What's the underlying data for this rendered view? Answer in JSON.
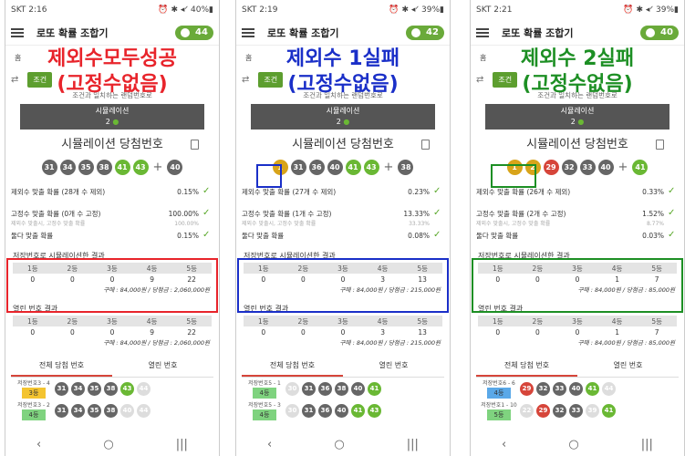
{
  "colors": {
    "red": "#e8242b",
    "blue": "#1a2fc8",
    "green": "#1d8f24",
    "badge_green": "#6aaa3a"
  },
  "phones": [
    {
      "status_time": "SKT 2:16",
      "status_right": "⏰ ✱ ◂ᐟ 40%▮",
      "app_title": "로또 확률 조합기",
      "count": "44",
      "nav_home": "홈",
      "filter_chip": "조건",
      "subtitle": "조건과 일치하는 랜덤번호로",
      "sim_label": "시뮬레이션",
      "sim_count": "2",
      "result_title": "시뮬레이션 당첨번호",
      "balls": [
        {
          "n": "31",
          "c": "gray"
        },
        {
          "n": "34",
          "c": "gray"
        },
        {
          "n": "35",
          "c": "gray"
        },
        {
          "n": "38",
          "c": "gray"
        },
        {
          "n": "41",
          "c": "green"
        },
        {
          "n": "43",
          "c": "green"
        }
      ],
      "bonus": {
        "n": "40",
        "c": "gray"
      },
      "prob1_label": "제외수 맞출 확률 (28개 수 제외)",
      "prob1_val": "0.15%",
      "prob2_label": "고정수 맞출 확률 (0개 수 고정)",
      "prob2_val": "100.00%",
      "note_label": "제외수 맞출시, 고정수 맞출 확률",
      "note_val": "100.00%",
      "prob3_label": "둘다 맞출 확률",
      "prob3_val": "0.15%",
      "saved_title": "저장번호로 시뮬레이션한 결과",
      "saved_vals": [
        "0",
        "0",
        "0",
        "9",
        "22"
      ],
      "saved_summary": "구매 : 84,000원 / 당첨금 : 2,060,000원",
      "open_title": "열린 번호 결과",
      "open_vals": [
        "0",
        "0",
        "0",
        "9",
        "22"
      ],
      "open_summary": "구매 : 84,000원 / 당첨금 : 2,060,000원",
      "tab1": "전체 당첨 번호",
      "tab2": "열린 번호",
      "hist": [
        {
          "label": "저장번호3 - 4",
          "rank": "3등",
          "rank_color": "#f4c430",
          "balls": [
            {
              "n": "31",
              "c": "gray"
            },
            {
              "n": "34",
              "c": "gray"
            },
            {
              "n": "35",
              "c": "gray"
            },
            {
              "n": "38",
              "c": "gray"
            },
            {
              "n": "43",
              "c": "green"
            },
            {
              "n": "44",
              "c": "light"
            }
          ]
        },
        {
          "label": "저장번호3 - 2",
          "rank": "4등",
          "rank_color": "#7fd37f",
          "balls": [
            {
              "n": "31",
              "c": "gray"
            },
            {
              "n": "34",
              "c": "gray"
            },
            {
              "n": "35",
              "c": "gray"
            },
            {
              "n": "38",
              "c": "gray"
            },
            {
              "n": "40",
              "c": "light"
            },
            {
              "n": "44",
              "c": "light"
            }
          ]
        }
      ],
      "overlay1": "제외수모두성공",
      "overlay2": "(고정수없음)",
      "overlay_color": "#e8242b"
    },
    {
      "status_time": "SKT 2:19",
      "status_right": "⏰ ✱ ◂ᐟ 39%▮",
      "app_title": "로또 확률 조합기",
      "count": "42",
      "nav_home": "홈",
      "filter_chip": "조건",
      "subtitle": "조건과 일치하는 랜덤번호로",
      "sim_label": "시뮬레이션",
      "sim_count": "2",
      "result_title": "시뮬레이션 당첨번호",
      "balls": [
        {
          "n": "1",
          "c": "yellow"
        },
        {
          "n": "31",
          "c": "gray"
        },
        {
          "n": "36",
          "c": "gray"
        },
        {
          "n": "40",
          "c": "gray"
        },
        {
          "n": "41",
          "c": "green"
        },
        {
          "n": "43",
          "c": "green"
        }
      ],
      "bonus": {
        "n": "38",
        "c": "gray"
      },
      "prob1_label": "제외수 맞출 확률 (27개 수 제외)",
      "prob1_val": "0.23%",
      "prob2_label": "고정수 맞출 확률 (1개 수 고정)",
      "prob2_val": "13.33%",
      "note_label": "제외수 맞출시, 고정수 맞출 확률",
      "note_val": "33.33%",
      "prob3_label": "둘다 맞출 확률",
      "prob3_val": "0.08%",
      "saved_title": "저장번호로 시뮬레이션한 결과",
      "saved_vals": [
        "0",
        "0",
        "0",
        "3",
        "13"
      ],
      "saved_summary": "구매 : 84,000원 / 당첨금 : 215,000원",
      "open_title": "열린 번호 결과",
      "open_vals": [
        "0",
        "0",
        "0",
        "3",
        "13"
      ],
      "open_summary": "구매 : 84,000원 / 당첨금 : 215,000원",
      "tab1": "전체 당첨 번호",
      "tab2": "열린 번호",
      "hist": [
        {
          "label": "저장번호5 - 1",
          "rank": "4등",
          "rank_color": "#7fd37f",
          "balls": [
            {
              "n": "30",
              "c": "light"
            },
            {
              "n": "31",
              "c": "gray"
            },
            {
              "n": "36",
              "c": "gray"
            },
            {
              "n": "38",
              "c": "gray"
            },
            {
              "n": "40",
              "c": "gray"
            },
            {
              "n": "41",
              "c": "green"
            }
          ]
        },
        {
          "label": "저장번호5 - 3",
          "rank": "4등",
          "rank_color": "#7fd37f",
          "balls": [
            {
              "n": "30",
              "c": "light"
            },
            {
              "n": "31",
              "c": "gray"
            },
            {
              "n": "36",
              "c": "gray"
            },
            {
              "n": "40",
              "c": "gray"
            },
            {
              "n": "41",
              "c": "green"
            },
            {
              "n": "43",
              "c": "green"
            }
          ]
        }
      ],
      "overlay1": "제외수 1실패",
      "overlay2": "(고정수없음)",
      "overlay_color": "#1a2fc8"
    },
    {
      "status_time": "SKT 2:21",
      "status_right": "⏰ ✱ ◂ᐟ 39%▮",
      "app_title": "로또 확률 조합기",
      "count": "40",
      "nav_home": "홈",
      "filter_chip": "조건",
      "subtitle": "조건과 일치하는 랜덤번호로",
      "sim_label": "시뮬레이션",
      "sim_count": "2",
      "result_title": "시뮬레이션 당첨번호",
      "balls": [
        {
          "n": "1",
          "c": "yellow"
        },
        {
          "n": "2",
          "c": "yellow"
        },
        {
          "n": "29",
          "c": "red"
        },
        {
          "n": "32",
          "c": "gray"
        },
        {
          "n": "33",
          "c": "gray"
        },
        {
          "n": "40",
          "c": "gray"
        }
      ],
      "bonus": {
        "n": "41",
        "c": "green"
      },
      "prob1_label": "제외수 맞출 확률 (26개 수 제외)",
      "prob1_val": "0.33%",
      "prob2_label": "고정수 맞출 확률 (2개 수 고정)",
      "prob2_val": "1.52%",
      "note_label": "제외수 맞출시, 고정수 맞출 확률",
      "note_val": "8.77%",
      "prob3_label": "둘다 맞출 확률",
      "prob3_val": "0.03%",
      "saved_title": "저장번호로 시뮬레이션한 결과",
      "saved_vals": [
        "0",
        "0",
        "0",
        "1",
        "7"
      ],
      "saved_summary": "구매 : 84,000원 / 당첨금 : 85,000원",
      "open_title": "열린 번호 결과",
      "open_vals": [
        "0",
        "0",
        "0",
        "1",
        "7"
      ],
      "open_summary": "구매 : 84,000원 / 당첨금 : 85,000원",
      "tab1": "전체 당첨 번호",
      "tab2": "열린 번호",
      "hist": [
        {
          "label": "저장번호6 - 6",
          "rank": "4등",
          "rank_color": "#5aa8e8",
          "balls": [
            {
              "n": "29",
              "c": "red"
            },
            {
              "n": "32",
              "c": "gray"
            },
            {
              "n": "33",
              "c": "gray"
            },
            {
              "n": "40",
              "c": "gray"
            },
            {
              "n": "41",
              "c": "green"
            },
            {
              "n": "44",
              "c": "light"
            }
          ]
        },
        {
          "label": "저장번호1 - 10",
          "rank": "5등",
          "rank_color": "#7fd37f",
          "balls": [
            {
              "n": "22",
              "c": "light"
            },
            {
              "n": "29",
              "c": "red"
            },
            {
              "n": "32",
              "c": "gray"
            },
            {
              "n": "33",
              "c": "gray"
            },
            {
              "n": "39",
              "c": "light"
            },
            {
              "n": "41",
              "c": "green"
            }
          ]
        }
      ],
      "overlay1": "제외수 2실패",
      "overlay2": "(고정수없음)",
      "overlay_color": "#1d8f24"
    }
  ],
  "rank_headers": [
    "1등",
    "2등",
    "3등",
    "4등",
    "5등"
  ],
  "nav_icons": {
    "back": "‹",
    "home": "○",
    "recent": "|||"
  }
}
